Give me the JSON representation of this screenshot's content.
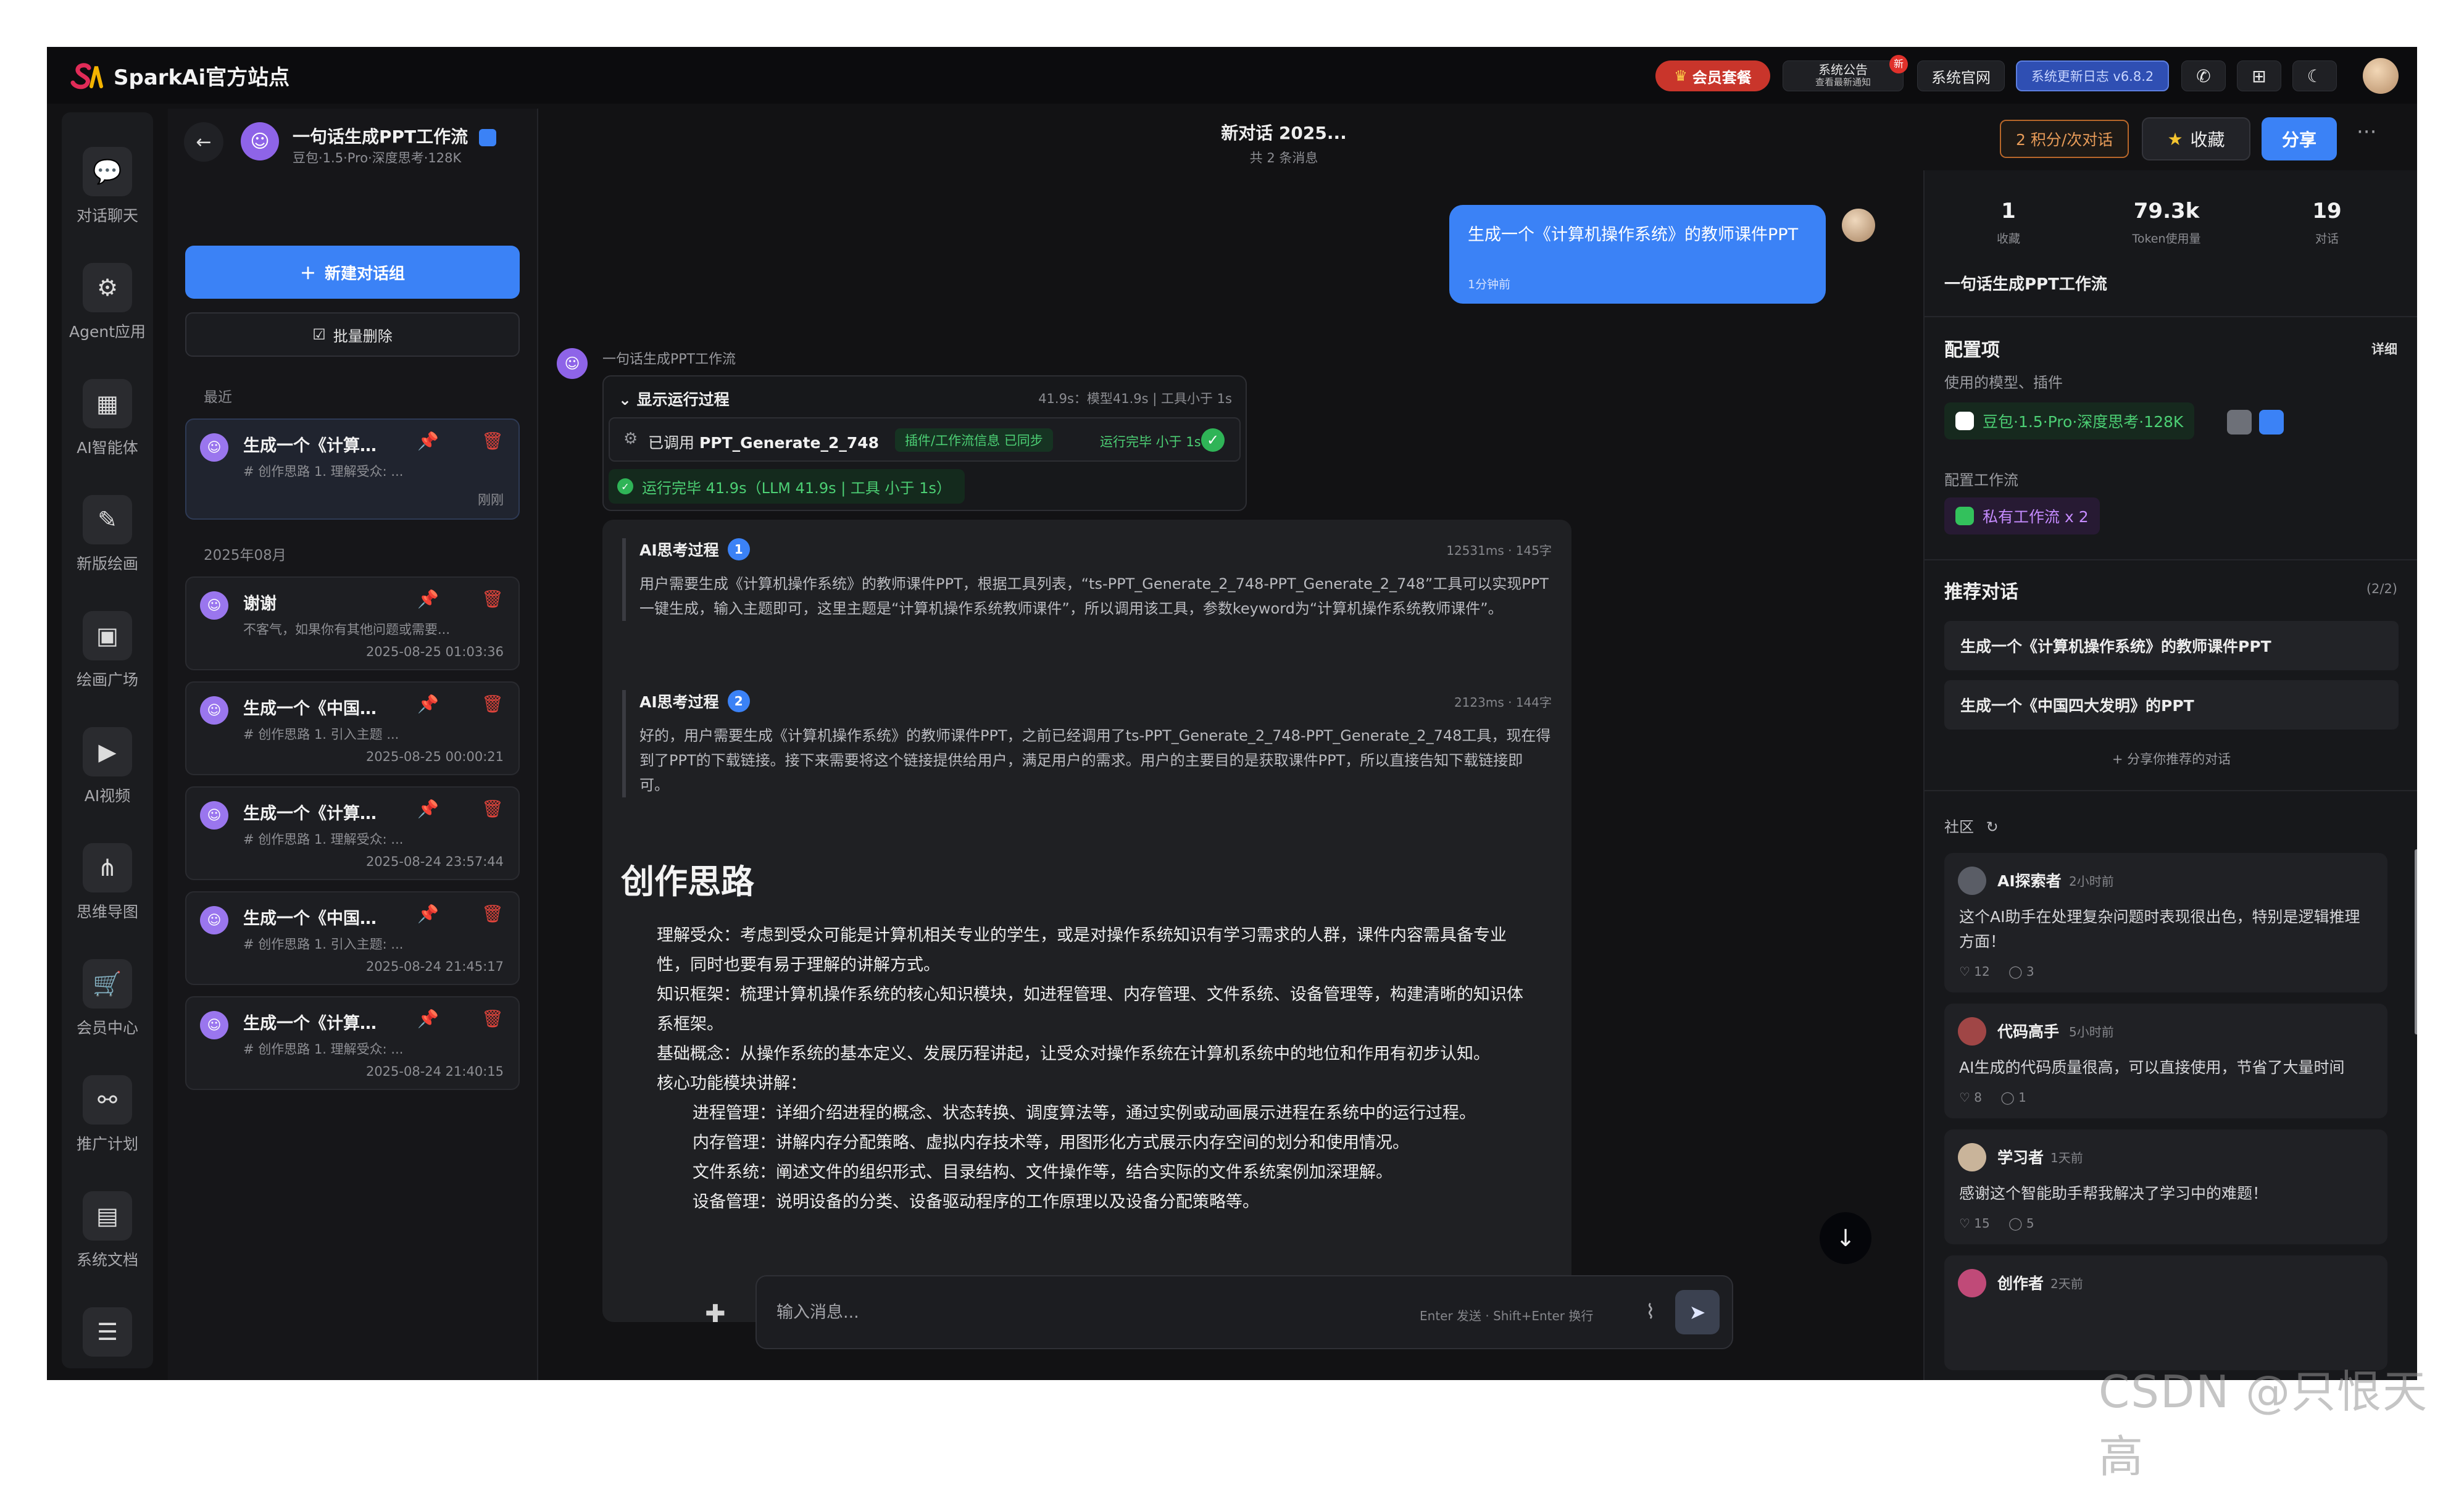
{
  "brand": {
    "name": "SparkAi官方站点"
  },
  "topbar": {
    "vip": "会员套餐",
    "notice_title": "系统公告",
    "notice_sub": "查看最新通知",
    "notice_badge": "新",
    "site": "系统官网",
    "changelog": "系统更新日志 v6.8.2"
  },
  "leftnav": {
    "items": [
      {
        "label": "对话聊天",
        "icon": "chat-icon",
        "glyph": "💬"
      },
      {
        "label": "Agent应用",
        "icon": "agent-icon",
        "glyph": "⚙"
      },
      {
        "label": "AI智能体",
        "icon": "grid-icon",
        "glyph": "▦"
      },
      {
        "label": "新版绘画",
        "icon": "brush-icon",
        "glyph": "✎"
      },
      {
        "label": "绘画广场",
        "icon": "gallery-icon",
        "glyph": "▣"
      },
      {
        "label": "AI视频",
        "icon": "video-icon",
        "glyph": "▶"
      },
      {
        "label": "思维导图",
        "icon": "mindmap-icon",
        "glyph": "⋔"
      },
      {
        "label": "会员中心",
        "icon": "cart-icon",
        "glyph": "🛒"
      },
      {
        "label": "推广计划",
        "icon": "share-icon",
        "glyph": "⚯"
      },
      {
        "label": "系统文档",
        "icon": "doc-icon",
        "glyph": "▤"
      },
      {
        "label": "",
        "icon": "archive-icon",
        "glyph": "☰"
      }
    ]
  },
  "sidebar": {
    "app_title": "一句话生成PPT工作流",
    "app_sub": "豆包·1.5·Pro·深度思考·128K",
    "new_group": "新建对话组",
    "batch_delete": "批量删除",
    "section_recent": "最近",
    "section_month": "2025年08月",
    "conversations": [
      {
        "title": "生成一个《计算…",
        "preview": "# 创作思路 1. 理解受众: ...",
        "time": "刚刚",
        "active": true
      },
      {
        "title": "谢谢",
        "preview": "不客气，如果你有其他问题或需要...",
        "time": "2025-08-25 01:03:36"
      },
      {
        "title": "生成一个《中国…",
        "preview": "# 创作思路 1. 引入主题 ...",
        "time": "2025-08-25 00:00:21"
      },
      {
        "title": "生成一个《计算…",
        "preview": "# 创作思路 1. 理解受众: ...",
        "time": "2025-08-24 23:57:44"
      },
      {
        "title": "生成一个《中国…",
        "preview": "# 创作思路 1. 引入主题: ...",
        "time": "2025-08-24 21:45:17"
      },
      {
        "title": "生成一个《计算…",
        "preview": "# 创作思路 1. 理解受众: ...",
        "time": "2025-08-24 21:40:15"
      }
    ]
  },
  "chat": {
    "title": "新对话 2025...",
    "subtitle": "共 2 条消息",
    "credits": "2 积分/次对话",
    "favorite": "收藏",
    "share": "分享",
    "user_message": "生成一个《计算机操作系统》的教师课件PPT",
    "user_time": "1分钟前",
    "bot_name": "一句话生成PPT工作流",
    "run": {
      "toggle": "显示运行过程",
      "meta": "41.9s：模型41.9s | 工具小于 1s",
      "step_prefix": "已调用",
      "step_name": "PPT_Generate_2_748",
      "step_tag": "插件/工作流信息 已同步",
      "step_status": "运行完毕 小于 1s",
      "done": "运行完毕 41.9s（LLM 41.9s | 工具 小于 1s）"
    },
    "think1": {
      "title": "AI思考过程",
      "num": "1",
      "meta": "12531ms · 145字",
      "body": "用户需要生成《计算机操作系统》的教师课件PPT，根据工具列表，“ts-PPT_Generate_2_748-PPT_Generate_2_748”工具可以实现PPT一键生成，输入主题即可，这里主题是“计算机操作系统教师课件”，所以调用该工具，参数keyword为“计算机操作系统教师课件”。"
    },
    "think2": {
      "title": "AI思考过程",
      "num": "2",
      "meta": "2123ms · 144字",
      "body": "好的，用户需要生成《计算机操作系统》的教师课件PPT，之前已经调用了ts-PPT_Generate_2_748-PPT_Generate_2_748工具，现在得到了PPT的下载链接。接下来需要将这个链接提供给用户，满足用户的需求。用户的主要目的是获取课件PPT，所以直接告知下载链接即可。"
    },
    "heading": "创作思路",
    "points": [
      "理解受众：考虑到受众可能是计算机相关专业的学生，或是对操作系统知识有学习需求的人群，课件内容需具备专业性，同时也要有易于理解的讲解方式。",
      "知识框架：梳理计算机操作系统的核心知识模块，如进程管理、内存管理、文件系统、设备管理等，构建清晰的知识体系框架。",
      "基础概念：从操作系统的基本定义、发展历程讲起，让受众对操作系统在计算机系统中的地位和作用有初步认知。",
      "核心功能模块讲解："
    ],
    "subpoints": [
      "进程管理：详细介绍进程的概念、状态转换、调度算法等，通过实例或动画展示进程在系统中的运行过程。",
      "内存管理：讲解内存分配策略、虚拟内存技术等，用图形化方式展示内存空间的划分和使用情况。",
      "文件系统：阐述文件的组织形式、目录结构、文件操作等，结合实际的文件系统案例加深理解。",
      "设备管理：说明设备的分类、设备驱动程序的工作原理以及设备分配策略等。"
    ],
    "input_placeholder": "输入消息...",
    "input_hint": "Enter 发送 · Shift+Enter 换行"
  },
  "right": {
    "stats": [
      {
        "value": "1",
        "label": "收藏"
      },
      {
        "value": "79.3k",
        "label": "Token使用量"
      },
      {
        "value": "19",
        "label": "对话"
      }
    ],
    "app_name": "一句话生成PPT工作流",
    "config_title": "配置项",
    "config_more": "详细",
    "config_models_label": "使用的模型、插件",
    "model_chip": "豆包·1.5·Pro·深度思考·128K",
    "workflow_label": "配置工作流",
    "workflow_chip": "私有工作流 x 2",
    "rec_title": "推荐对话",
    "rec_count": "(2/2)",
    "rec_items": [
      "生成一个《计算机操作系统》的教师课件PPT",
      "生成一个《中国四大发明》的PPT"
    ],
    "rec_share": "+ 分享你推荐的对话",
    "community_title": "社区",
    "posts": [
      {
        "name": "AI探索者",
        "time": "2小时前",
        "text": "这个AI助手在处理复杂问题时表现很出色，特别是逻辑推理方面！",
        "likes": "♡ 12",
        "comments": "◯ 3"
      },
      {
        "name": "代码高手",
        "time": "5小时前",
        "text": "AI生成的代码质量很高，可以直接使用，节省了大量时间",
        "likes": "♡ 8",
        "comments": "◯ 1"
      },
      {
        "name": "学习者",
        "time": "1天前",
        "text": "感谢这个智能助手帮我解决了学习中的难题！",
        "likes": "♡ 15",
        "comments": "◯ 5"
      },
      {
        "name": "创作者",
        "time": "2天前",
        "text": "",
        "likes": "",
        "comments": ""
      }
    ]
  },
  "watermark": "CSDN @只恨天高",
  "colors": {
    "accent": "#3b82f6",
    "danger": "#e2453c",
    "success": "#4ccf74",
    "vip": "#c9352b"
  }
}
